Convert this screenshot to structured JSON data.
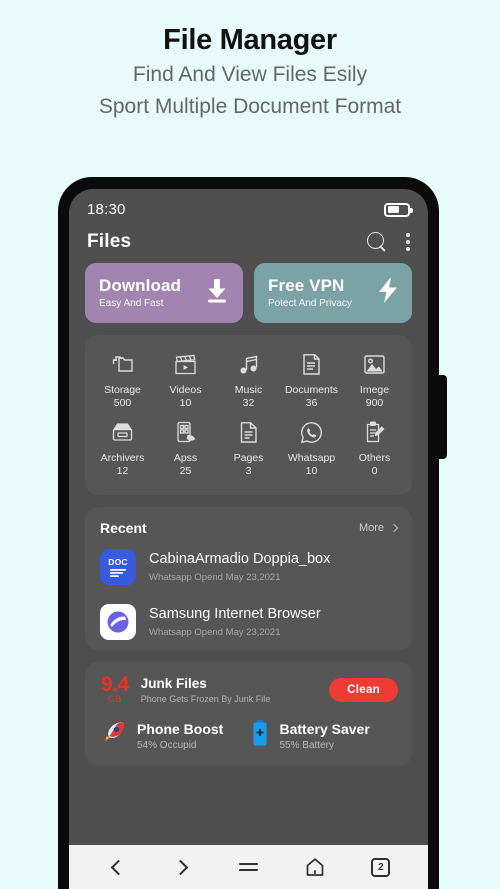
{
  "header": {
    "title": "File Manager",
    "subtitle_line1": "Find And View Files Esily",
    "subtitle_line2": "Sport Multiple Document Format"
  },
  "phone": {
    "status": {
      "time": "18:30",
      "battery_icon": "battery-icon"
    },
    "appbar": {
      "title": "Files",
      "search_icon": "search-icon",
      "overflow_icon": "more-vertical-icon"
    },
    "promos": [
      {
        "title": "Download",
        "subtitle": "Easy And Fast",
        "icon": "download-icon",
        "color": "#A184AF"
      },
      {
        "title": "Free VPN",
        "subtitle": "Potect And Privacy",
        "icon": "bolt-icon",
        "color": "#7BA3A5"
      }
    ],
    "categories": [
      {
        "label": "Storage",
        "count": "500",
        "icon": "folders-icon"
      },
      {
        "label": "Videos",
        "count": "10",
        "icon": "clapperboard-icon"
      },
      {
        "label": "Music",
        "count": "32",
        "icon": "music-note-icon"
      },
      {
        "label": "Documents",
        "count": "36",
        "icon": "document-icon"
      },
      {
        "label": "Imege",
        "count": "900",
        "icon": "image-icon"
      },
      {
        "label": "Archivers",
        "count": "12",
        "icon": "archive-drawer-icon"
      },
      {
        "label": "Apss",
        "count": "25",
        "icon": "phone-apps-icon"
      },
      {
        "label": "Pages",
        "count": "3",
        "icon": "page-lines-icon"
      },
      {
        "label": "Whatsapp",
        "count": "10",
        "icon": "whatsapp-icon"
      },
      {
        "label": "Others",
        "count": "0",
        "icon": "clipboard-pen-icon"
      }
    ],
    "recent": {
      "title": "Recent",
      "more_label": "More",
      "more_icon": "chevron-right-icon",
      "items": [
        {
          "name": "CabinaArmadio Doppia_box",
          "meta": "Whatsapp Opend May 23,2021",
          "icon": "doc-file-icon",
          "icon_label": "DOC",
          "icon_color": "#3A5BD9"
        },
        {
          "name": "Samsung Internet Browser",
          "meta": "Whatsapp Opend May 23,2021",
          "icon": "samsung-browser-icon",
          "icon_label": "",
          "icon_color": "#FFFFFF"
        }
      ]
    },
    "junk": {
      "amount": "9.4",
      "unit": "GB",
      "title": "Junk Files",
      "subtitle": "Phone Gets Frozen By Junk File",
      "clean_label": "Clean",
      "clean_color": "#EE3B35"
    },
    "tools": [
      {
        "title": "Phone Boost",
        "subtitle": "54% Occupid",
        "icon": "rocket-icon"
      },
      {
        "title": "Battery Saver",
        "subtitle": "55% Battery",
        "icon": "battery-blue-icon"
      }
    ],
    "navbar": {
      "back_icon": "chevron-left-icon",
      "forward_icon": "chevron-right-icon",
      "menu_icon": "hamburger-menu-icon",
      "home_icon": "home-icon",
      "tabs_icon": "tabs-count-icon",
      "tabs_count": "2"
    }
  },
  "colors": {
    "page_bg": "#E8FBFB",
    "screen_bg": "#4F4F4F",
    "card_bg": "#565656",
    "frame": "#0B0B0B"
  }
}
